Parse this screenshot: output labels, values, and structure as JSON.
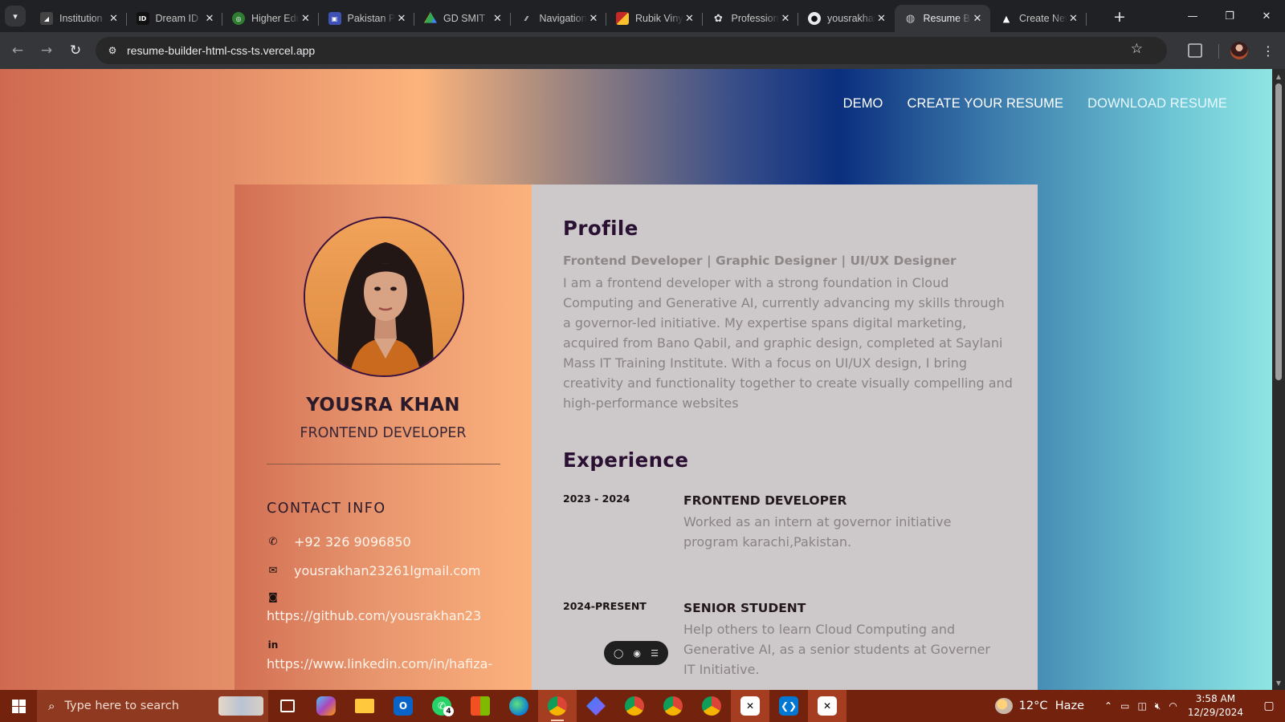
{
  "browser": {
    "tabs": [
      {
        "label": "Institution",
        "favicon": "institution-icon",
        "color": "#444444"
      },
      {
        "label": "Dream ID",
        "favicon": "dream-id-icon",
        "color": "#111111"
      },
      {
        "label": "Higher Education",
        "favicon": "hec-icon",
        "color": "#2e7d32"
      },
      {
        "label": "Pakistan Portal",
        "favicon": "pakistan-portal-icon",
        "color": "#3f51b5"
      },
      {
        "label": "GD SMIT",
        "favicon": "google-drive-icon",
        "color": "#1e88e5"
      },
      {
        "label": "Navigation",
        "favicon": "navigation-icon",
        "color": "#555555"
      },
      {
        "label": "Rubik Vinyl",
        "favicon": "rubik-icon",
        "color": "#c62828"
      },
      {
        "label": "Professional",
        "favicon": "openai-icon",
        "color": "#333333"
      },
      {
        "label": "yousrakhan",
        "favicon": "github-icon",
        "color": "#111111"
      },
      {
        "label": "Resume Builder",
        "favicon": "globe-icon",
        "color": "#5f6368",
        "active": true
      },
      {
        "label": "Create New",
        "favicon": "vercel-icon",
        "color": "#000000"
      }
    ],
    "url": "resume-builder-html-css-ts.vercel.app"
  },
  "nav": {
    "demo": "DEMO",
    "create": "CREATE YOUR RESUME",
    "download": "DOWNLOAD RESUME"
  },
  "resume": {
    "name": "YOUSRA KHAN",
    "role": "FRONTEND DEVELOPER",
    "contact_heading": "CONTACT INFO",
    "phone": "+92 326 9096850",
    "email": "yousrakhan23261lgmail.com",
    "github": "https://github.com/yousrakhan23",
    "linkedin": "https://www.linkedin.com/in/hafiza-",
    "profile": {
      "heading": "Profile",
      "subtitle": "Frontend Developer | Graphic Designer | UI/UX Designer",
      "text": "I am a frontend developer with a strong foundation in Cloud Computing and Generative AI, currently advancing my skills through a governor-led initiative. My expertise spans digital marketing, acquired from Bano Qabil, and graphic design, completed at Saylani Mass IT Training Institute. With a focus on UI/UX design, I bring creativity and functionality together to create visually compelling and high-performance websites"
    },
    "experience": {
      "heading": "Experience",
      "items": [
        {
          "date": "2023 - 2024",
          "title": "FRONTEND DEVELOPER",
          "desc": "Worked as an intern at governor initiative program karachi,Pakistan."
        },
        {
          "date": "2024-PRESENT",
          "title": "SENIOR STUDENT",
          "desc": "Help others to learn Cloud Computing and Generative AI, as a senior students at Governer IT Initiative."
        }
      ]
    }
  },
  "taskbar": {
    "search_placeholder": "Type here to search",
    "temperature": "12°C",
    "weather": "Haze",
    "time": "3:58 AM",
    "date": "12/29/2024",
    "whatsapp_badge": "4"
  }
}
